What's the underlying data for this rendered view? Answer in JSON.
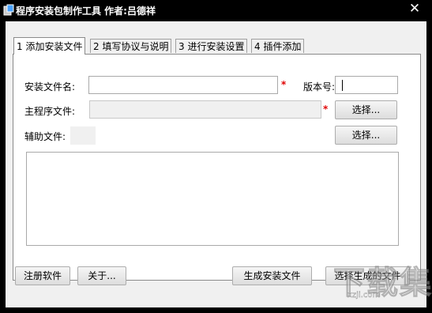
{
  "window": {
    "title": "程序安装包制作工具 作者:吕德祥",
    "close_glyph": "✕"
  },
  "tabs": [
    {
      "label": "1 添加安装文件",
      "active": true
    },
    {
      "label": "2 填写协议与说明",
      "active": false
    },
    {
      "label": "3 进行安装设置",
      "active": false
    },
    {
      "label": "4 插件添加",
      "active": false
    }
  ],
  "form": {
    "install_name_label": "安装文件名:",
    "install_name_value": "",
    "version_label": "版本号:",
    "version_value": "",
    "main_program_label": "主程序文件:",
    "main_program_value": "",
    "aux_files_label": "辅助文件:",
    "required_mark": "*",
    "browse_main_label": "选择...",
    "browse_aux_label": "选择..."
  },
  "footer": {
    "register_label": "注册软件",
    "about_label": "关于...",
    "generate_label": "生成安装文件",
    "choose_generated_label": "选择生成的文件"
  },
  "watermark": {
    "main": "下载集",
    "sub": "xzji.com"
  },
  "colors": {
    "required": "#e00000",
    "titlebar": "#000000",
    "client": "#f0f0f0"
  }
}
